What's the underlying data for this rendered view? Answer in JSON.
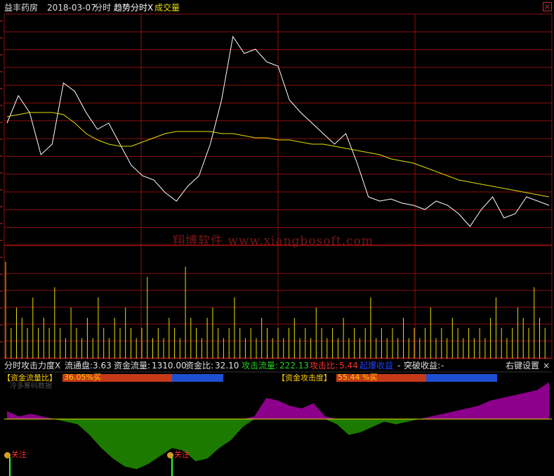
{
  "header": {
    "stock_name": "益丰药房",
    "date": "2018-03-07",
    "mode": "分时",
    "indicator": "趋势分时X",
    "volume_label": "成交量"
  },
  "colors": {
    "background": "#000000",
    "grid": "#8a0f0f",
    "price_line": "#ffffff",
    "avg_line": "#e8e000",
    "volume_bar": "#e8e000",
    "positive_area": "#8c008c",
    "negative_area": "#1d7a00"
  },
  "watermark": "翔博软件 www.xiangbosoft.com",
  "stats": {
    "name": "分时攻击力度X",
    "float_label": "流通盘:",
    "float_value": "3.63",
    "flow_label": "资金流量:",
    "flow_value": "1310.00",
    "ratio_label": "资金比:",
    "ratio_value": "32.10",
    "attack_flow_label": "攻击流量:",
    "attack_flow_value": "222.13",
    "attack_ratio_label": "攻击比:",
    "attack_ratio_value": "5.44",
    "surge_label": "起爆收益",
    "surge_value": "-",
    "break_label": "突破收益:",
    "break_value": "-",
    "settings_label": "右键设置",
    "close_label": "×"
  },
  "indicators": {
    "fund_flow_label": "【资金流量比】",
    "fund_flow_value": "36.05%买",
    "fund_flow_fraction": 0.68,
    "fund_attack_label": "【资金攻击度】",
    "fund_attack_value": "55.44 %买",
    "fund_attack_fraction": 0.56,
    "hidden_label": "冷多筹码数据"
  },
  "markers": [
    {
      "label": "关注"
    },
    {
      "label": "关注"
    }
  ],
  "chart_data": [
    {
      "type": "line",
      "title": "",
      "series": [
        {
          "name": "",
          "values": [
            0.55,
            0.68,
            0.6,
            0.4,
            0.45,
            0.74,
            0.7,
            0.6,
            0.52,
            0.55,
            0.45,
            0.35,
            0.3,
            0.28,
            0.22,
            0.18,
            0.25,
            0.3,
            0.45,
            0.66,
            0.96,
            0.88,
            0.9,
            0.84,
            0.82,
            0.66,
            0.6,
            0.55,
            0.5,
            0.45,
            0.5,
            0.36,
            0.2,
            0.18,
            0.19,
            0.17,
            0.16,
            0.14,
            0.18,
            0.16,
            0.12,
            0.06,
            0.14,
            0.2,
            0.1,
            0.12,
            0.2,
            0.18,
            0.16
          ]
        },
        {
          "name": "",
          "values": [
            0.58,
            0.59,
            0.6,
            0.6,
            0.6,
            0.59,
            0.55,
            0.5,
            0.47,
            0.45,
            0.44,
            0.44,
            0.46,
            0.48,
            0.5,
            0.51,
            0.51,
            0.51,
            0.51,
            0.5,
            0.5,
            0.49,
            0.48,
            0.48,
            0.47,
            0.47,
            0.46,
            0.45,
            0.45,
            0.44,
            0.43,
            0.42,
            0.41,
            0.4,
            0.38,
            0.37,
            0.36,
            0.34,
            0.32,
            0.3,
            0.28,
            0.27,
            0.26,
            0.25,
            0.24,
            0.23,
            0.22,
            0.21,
            0.2
          ]
        }
      ]
    },
    {
      "type": "bar",
      "title": "",
      "series": [
        {
          "name": "成交量",
          "values": [
            0.95,
            0.3,
            0.5,
            0.4,
            0.3,
            0.6,
            0.3,
            0.4,
            0.3,
            0.7,
            0.3,
            0.2,
            0.5,
            0.3,
            0.2,
            0.4,
            0.2,
            0.6,
            0.3,
            0.2,
            0.4,
            0.3,
            0.5,
            0.3,
            0.2,
            0.3,
            0.8,
            0.2,
            0.3,
            0.2,
            0.4,
            0.3,
            0.2,
            0.9,
            0.4,
            0.3,
            0.2,
            0.4,
            0.5,
            0.3,
            0.2,
            0.3,
            0.6,
            0.3,
            0.2,
            0.3,
            0.2,
            0.4,
            0.3,
            0.2,
            0.3,
            0.2,
            0.3,
            0.4,
            0.2,
            0.3,
            0.2,
            0.5,
            0.3,
            0.2,
            0.3,
            0.2,
            0.4,
            0.2,
            0.3,
            0.2,
            0.3,
            0.6,
            0.2,
            0.3,
            0.2,
            0.3,
            0.2,
            0.4,
            0.2,
            0.3,
            0.2,
            0.3,
            0.5,
            0.2,
            0.3,
            0.2,
            0.4,
            0.3,
            0.2,
            0.3,
            0.2,
            0.3,
            0.2,
            0.4,
            0.6,
            0.3,
            0.2,
            0.3,
            0.5,
            0.4,
            0.3,
            0.7,
            0.4,
            0.3
          ]
        }
      ]
    },
    {
      "type": "area",
      "title": "",
      "series": [
        {
          "name": "",
          "values": [
            0.15,
            0.05,
            0.1,
            0.05,
            0.0,
            -0.05,
            -0.1,
            -0.3,
            -0.55,
            -0.75,
            -0.9,
            -0.95,
            -0.85,
            -0.7,
            -0.55,
            -0.6,
            -0.8,
            -0.75,
            -0.55,
            -0.4,
            -0.15,
            0.05,
            0.4,
            0.35,
            0.25,
            0.2,
            0.3,
            0.05,
            -0.1,
            -0.3,
            -0.25,
            -0.15,
            -0.05,
            -0.1,
            -0.05,
            0.0,
            0.05,
            0.1,
            0.15,
            0.2,
            0.25,
            0.35,
            0.4,
            0.45,
            0.5,
            0.55,
            0.7
          ]
        }
      ]
    }
  ]
}
